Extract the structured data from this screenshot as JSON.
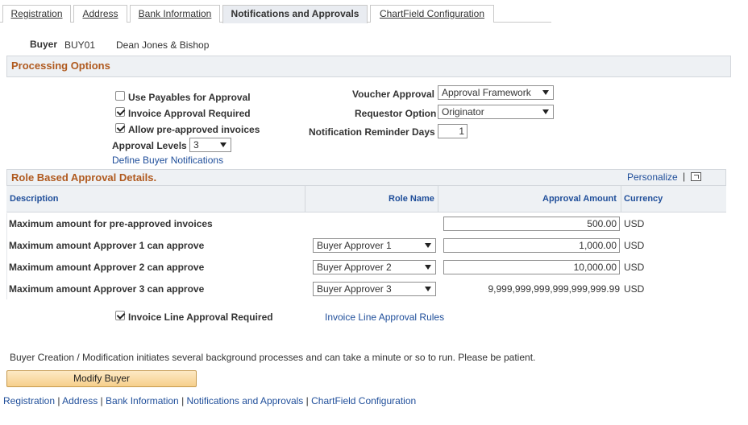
{
  "tabs": [
    {
      "label": "Registration",
      "active": false
    },
    {
      "label": "Address",
      "active": false
    },
    {
      "label": "Bank Information",
      "active": false
    },
    {
      "label": "Notifications and Approvals",
      "active": true
    },
    {
      "label": "ChartField Configuration",
      "active": false
    }
  ],
  "buyer": {
    "label": "Buyer",
    "id": "BUY01",
    "name": "Dean Jones & Bishop"
  },
  "processing": {
    "title": "Processing Options",
    "use_payables_label": "Use Payables for Approval",
    "use_payables_checked": false,
    "invoice_approval_label": "Invoice Approval Required",
    "invoice_approval_checked": true,
    "allow_preapproved_label": "Allow pre-approved invoices",
    "allow_preapproved_checked": true,
    "approval_levels_label": "Approval Levels",
    "approval_levels_value": "3",
    "define_notifications_link": "Define Buyer Notifications",
    "voucher_approval_label": "Voucher Approval",
    "voucher_approval_value": "Approval Framework",
    "requestor_option_label": "Requestor Option",
    "requestor_option_value": "Originator",
    "reminder_days_label": "Notification Reminder Days",
    "reminder_days_value": "1"
  },
  "role_grid": {
    "title": "Role Based Approval Details.",
    "personalize": "Personalize",
    "separator": "|",
    "headers": {
      "description": "Description",
      "role": "Role Name",
      "amount": "Approval Amount",
      "currency": "Currency"
    },
    "rows": [
      {
        "description": "Maximum amount for pre-approved invoices",
        "role": "",
        "amount": "500.00",
        "currency": "USD"
      },
      {
        "description": "Maximum amount Approver 1 can approve",
        "role": "Buyer Approver 1",
        "amount": "1,000.00",
        "currency": "USD"
      },
      {
        "description": "Maximum amount Approver 2 can approve",
        "role": "Buyer Approver 2",
        "amount": "10,000.00",
        "currency": "USD"
      },
      {
        "description": "Maximum amount Approver 3 can approve",
        "role": "Buyer Approver 3",
        "amount": "9,999,999,999,999,999,999.99",
        "currency": "USD"
      }
    ]
  },
  "invoice_line": {
    "label": "Invoice Line Approval Required",
    "checked": true,
    "rules_link": "Invoice Line Approval Rules"
  },
  "footer": {
    "note": "Buyer Creation / Modification initiates several background processes and can take a minute or so to run. Please be patient.",
    "modify_button": "Modify Buyer",
    "links": [
      "Registration",
      "Address",
      "Bank Information",
      "Notifications and Approvals",
      "ChartField Configuration"
    ],
    "separator": "|"
  }
}
